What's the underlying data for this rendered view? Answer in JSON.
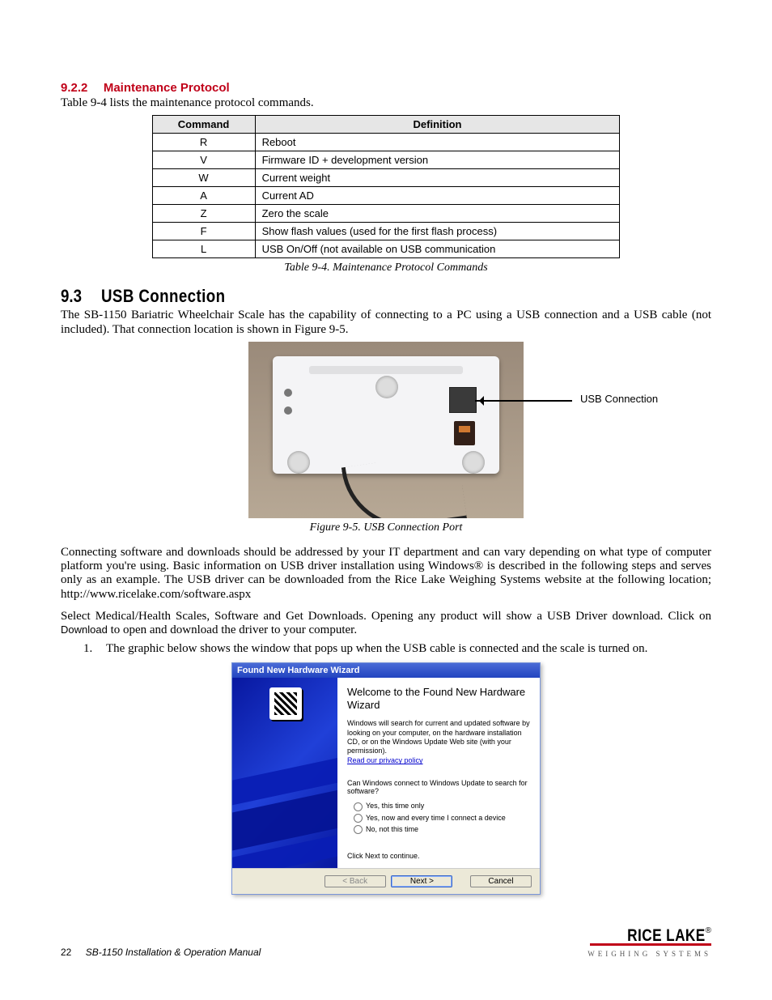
{
  "section922": {
    "num": "9.2.2",
    "title": "Maintenance Protocol",
    "intro": "Table 9-4 lists the maintenance protocol commands."
  },
  "table94": {
    "headers": {
      "command": "Command",
      "definition": "Definition"
    },
    "rows": [
      {
        "cmd": "R",
        "def": "Reboot"
      },
      {
        "cmd": "V",
        "def": "Firmware ID + development version"
      },
      {
        "cmd": "W",
        "def": "Current weight"
      },
      {
        "cmd": "A",
        "def": "Current AD"
      },
      {
        "cmd": "Z",
        "def": "Zero the scale"
      },
      {
        "cmd": "F",
        "def": "Show flash values (used for the first flash process)"
      },
      {
        "cmd": "L",
        "def": "USB On/Off (not available on USB communication"
      }
    ],
    "caption": "Table 9-4. Maintenance Protocol Commands"
  },
  "section93": {
    "num": "9.3",
    "title": "USB Connection",
    "para1": "The SB-1150 Bariatric Wheelchair Scale has the capability of connecting to a PC using a USB connection and a USB cable (not included). That connection location is shown in Figure 9-5.",
    "fig_label": "USB Connection",
    "fig_caption": "Figure 9-5. USB Connection Port",
    "para2": "Connecting software and downloads should be addressed by your IT department and can vary depending on what type of computer platform you're using. Basic information on USB driver installation using Windows® is described in the following steps and serves only as an example. The USB driver can be downloaded from the Rice Lake Weighing Systems website at the following location; http://www.ricelake.com/software.aspx",
    "para3_a": "Select Medical/Health Scales, Software and Get Downloads. Opening any product will show a USB Driver download. Click on ",
    "para3_dl": "Download",
    "para3_b": " to open and download the driver to your computer.",
    "step1_num": "1.",
    "step1": "The graphic below shows the window that pops up when the USB cable is connected and the scale is turned on."
  },
  "wizard": {
    "titlebar": "Found New Hardware Wizard",
    "heading": "Welcome to the Found New Hardware Wizard",
    "text1": "Windows will search for current and updated software by looking on your computer, on the hardware installation CD, or on the Windows Update Web site (with your permission).",
    "privacy": "Read our privacy policy",
    "question": "Can Windows connect to Windows Update to search for software?",
    "opt1": "Yes, this time only",
    "opt2": "Yes, now and every time I connect a device",
    "opt3": "No, not this time",
    "continue": "Click Next to continue.",
    "back": "< Back",
    "next": "Next >",
    "cancel": "Cancel"
  },
  "footer": {
    "page": "22",
    "doc": "SB-1150 Installation & Operation Manual",
    "logo_name": "RICE LAKE",
    "logo_sub": "WEIGHING SYSTEMS"
  }
}
